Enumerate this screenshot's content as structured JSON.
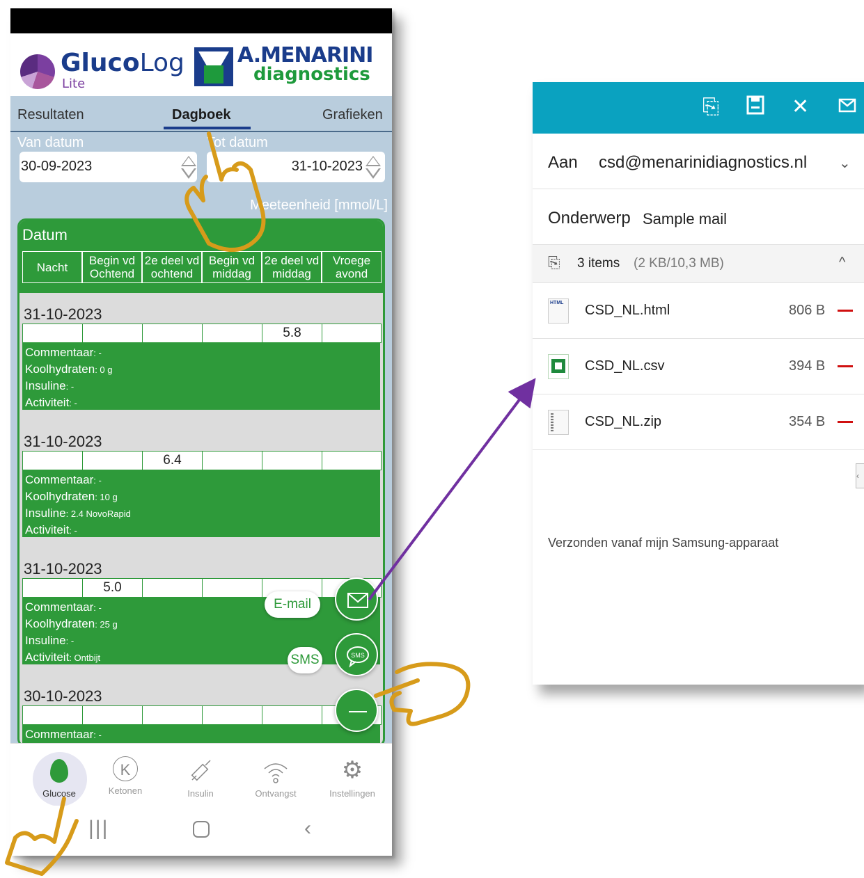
{
  "phone": {
    "logo": {
      "brand_bold": "Gluco",
      "brand_light": "Log",
      "edition": "Lite",
      "partner_title": "A.MENARINI",
      "partner_sub": "diagnostics"
    },
    "tabs": [
      "Resultaten",
      "Dagboek",
      "Grafieken"
    ],
    "from_date_label": "Van datum",
    "to_date_label": "Tot datum",
    "from_date": "30-09-2023",
    "to_date": "31-10-2023",
    "unit_label": "Meeteenheid [mmol/L]",
    "diary_title": "Datum",
    "columns": [
      "Nacht",
      "Begin vd Ochtend",
      "2e deel vd ochtend",
      "Begin vd middag",
      "2e deel vd middag",
      "Vroege avond"
    ],
    "entries": [
      {
        "date": "31-10-2023",
        "values": [
          "",
          "",
          "",
          "",
          "5.8",
          ""
        ],
        "comment_label": "Commentaar",
        "comment": ": -",
        "carb_label": "Koolhydraten",
        "carb": ": 0 g",
        "insulin_label": "Insuline",
        "insulin": ": -",
        "activity_label": "Activiteit",
        "activity": ": -"
      },
      {
        "date": "31-10-2023",
        "values": [
          "",
          "",
          "6.4",
          "",
          "",
          ""
        ],
        "comment_label": "Commentaar",
        "comment": ": -",
        "carb_label": "Koolhydraten",
        "carb": ": 10 g",
        "insulin_label": "Insuline",
        "insulin": ": 2.4 NovoRapid",
        "activity_label": "Activiteit",
        "activity": ": -"
      },
      {
        "date": "31-10-2023",
        "values": [
          "",
          "5.0",
          "",
          "",
          "",
          ""
        ],
        "comment_label": "Commentaar",
        "comment": ": -",
        "carb_label": "Koolhydraten",
        "carb": ": 25 g",
        "insulin_label": "Insuline",
        "insulin": ": -",
        "activity_label": "Activiteit",
        "activity": ": Ontbijt"
      },
      {
        "date": "30-10-2023",
        "values": [
          "",
          "",
          "",
          "",
          "",
          ""
        ],
        "comment_label": "Commentaar",
        "comment": ": -"
      }
    ],
    "fab": {
      "email_label": "E-mail",
      "sms_label": "SMS",
      "sms_icon_text": "SMS"
    },
    "bottom_nav": [
      "Glucose",
      "Ketonen",
      "Insulin",
      "Ontvangst",
      "Instellingen"
    ],
    "icons": {
      "ketone": "K"
    }
  },
  "mail": {
    "to_label": "Aan",
    "to_value": "csd@menarinidiagnostics.nl",
    "subject_label": "Onderwerp",
    "subject_value": "Sample mail",
    "attachments_count": "3 items",
    "attachments_size": "(2 KB/10,3 MB)",
    "files": [
      {
        "name": "CSD_NL.html",
        "size": "806 B",
        "type_badge": "HTML"
      },
      {
        "name": "CSD_NL.csv",
        "size": "394 B"
      },
      {
        "name": "CSD_NL.zip",
        "size": "354 B"
      }
    ],
    "signature": "Verzonden vanaf mijn Samsung-apparaat"
  },
  "colors": {
    "app_green": "#2e9a3a",
    "mail_header": "#0aa2c0",
    "arrow": "#7030a0",
    "hand": "#d79b1a"
  }
}
